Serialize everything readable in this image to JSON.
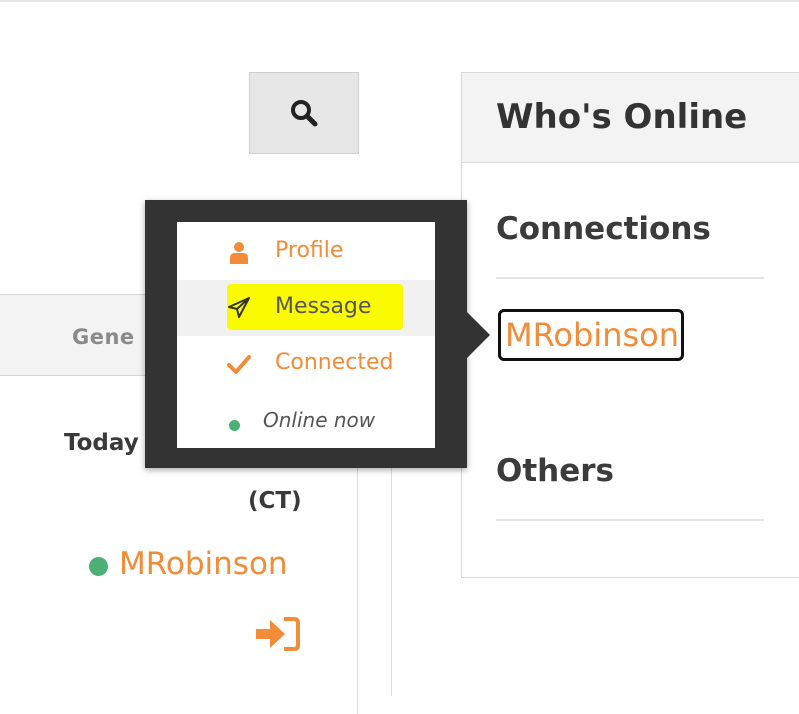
{
  "left_panel": {
    "header_label": "Gene",
    "today_label": "Today",
    "timezone": "(CT)",
    "user": "MRobinson"
  },
  "right_panel": {
    "title": "Who's Online",
    "sections": [
      {
        "title": "Connections"
      },
      {
        "title": "Others"
      }
    ],
    "connection_user": "MRobinson"
  },
  "popover": {
    "items": [
      {
        "label": "Profile",
        "icon": "user-icon"
      },
      {
        "label": "Message",
        "icon": "paper-plane-icon"
      },
      {
        "label": "Connected",
        "icon": "check-icon"
      }
    ],
    "status": "Online now"
  },
  "colors": {
    "accent": "#f28c38",
    "online": "#4caf76",
    "highlight": "#fafa00",
    "popover_bg": "#333333"
  }
}
